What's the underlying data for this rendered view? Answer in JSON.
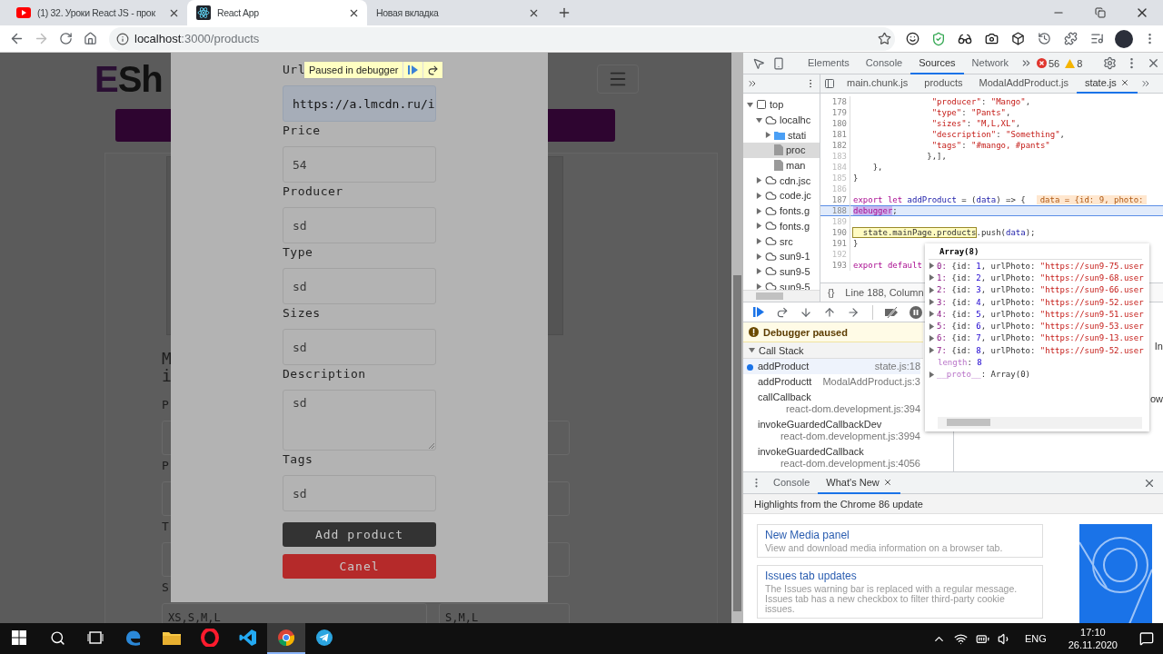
{
  "browser": {
    "tabs": [
      {
        "title": "(1) 32. Уроки React JS - прок",
        "kind": "youtube",
        "selected": false
      },
      {
        "title": "React App",
        "kind": "react",
        "selected": true
      },
      {
        "title": "Новая вкладка",
        "selected": false
      }
    ],
    "address": {
      "host": "localhost",
      "path": ":3000/products"
    }
  },
  "page": {
    "logo": {
      "first": "E",
      "rest": "Sh"
    },
    "title_lines": [
      "M",
      "i"
    ],
    "form_rows": [
      {
        "label": "P"
      },
      {
        "label": "P"
      },
      {
        "label": "T"
      },
      {
        "label": "S",
        "left_value": "XS,S,M,L",
        "right_value": "S,M,L"
      }
    ]
  },
  "modal": {
    "fields": [
      {
        "label": "Url",
        "value": "https://a.lmcdn.ru/i",
        "kind": "input",
        "autofilled": true
      },
      {
        "label": "Price",
        "value": "54",
        "kind": "input",
        "autofilled": false
      },
      {
        "label": "Producer",
        "value": "sd",
        "kind": "input",
        "autofilled": false
      },
      {
        "label": "Type",
        "value": "sd",
        "kind": "input",
        "autofilled": false
      },
      {
        "label": "Sizes",
        "value": "sd",
        "kind": "input",
        "autofilled": false
      },
      {
        "label": "Description",
        "value": "sd",
        "kind": "textarea",
        "autofilled": false
      },
      {
        "label": "Tags",
        "value": "sd",
        "kind": "input",
        "autofilled": false
      }
    ],
    "buttons": [
      {
        "label": "Add product",
        "kind": "primary"
      },
      {
        "label": "Canel",
        "kind": "danger"
      }
    ]
  },
  "debugger_badge": {
    "text": "Paused in debugger"
  },
  "devtools": {
    "panel_tabs": [
      {
        "label": "Elements",
        "selected": false
      },
      {
        "label": "Console",
        "selected": false
      },
      {
        "label": "Sources",
        "selected": true
      },
      {
        "label": "Network",
        "selected": false
      }
    ],
    "errors": "56",
    "warnings": "8",
    "file_tabs": [
      {
        "label": "main.chunk.js",
        "selected": false
      },
      {
        "label": "products",
        "selected": false
      },
      {
        "label": "ModalAddProduct.js",
        "selected": false
      },
      {
        "label": "state.js",
        "selected": true
      }
    ],
    "navigator": [
      {
        "label": "top",
        "kind": "frame",
        "selected": false,
        "expanded": true,
        "children": [
          {
            "label": "localhc",
            "kind": "cloud",
            "selected": false,
            "expanded": true,
            "children": [
              {
                "label": "stati",
                "kind": "folder",
                "selected": false,
                "expanded": false
              },
              {
                "label": "proc",
                "kind": "file",
                "selected": true
              },
              {
                "label": "man",
                "kind": "file",
                "selected": false
              }
            ]
          },
          {
            "label": "cdn.jsc",
            "kind": "cloud",
            "selected": false,
            "expanded": false
          },
          {
            "label": "code.jc",
            "kind": "cloud",
            "selected": false,
            "expanded": false
          },
          {
            "label": "fonts.g",
            "kind": "cloud",
            "selected": false,
            "expanded": false
          },
          {
            "label": "fonts.g",
            "kind": "cloud",
            "selected": false,
            "expanded": false
          },
          {
            "label": "src",
            "kind": "cloud",
            "selected": false,
            "expanded": false
          },
          {
            "label": "sun9-1",
            "kind": "cloud",
            "selected": false,
            "expanded": false
          },
          {
            "label": "sun9-5",
            "kind": "cloud",
            "selected": false,
            "expanded": false
          },
          {
            "label": "sun9-5",
            "kind": "cloud",
            "selected": false,
            "expanded": false
          }
        ]
      }
    ],
    "code_lines": [
      {
        "number": "178",
        "muted": false,
        "current": false,
        "tokens": [
          {
            "kind": "s",
            "t": "                \"producer\""
          },
          {
            "kind": "p",
            "t": ": "
          },
          {
            "kind": "s",
            "t": "\"Mango\""
          },
          {
            "kind": "p",
            "t": ","
          }
        ]
      },
      {
        "number": "179",
        "muted": false,
        "current": false,
        "tokens": [
          {
            "kind": "s",
            "t": "                \"type\""
          },
          {
            "kind": "p",
            "t": ": "
          },
          {
            "kind": "s",
            "t": "\"Pants\""
          },
          {
            "kind": "p",
            "t": ","
          }
        ]
      },
      {
        "number": "180",
        "muted": false,
        "current": false,
        "tokens": [
          {
            "kind": "s",
            "t": "                \"sizes\""
          },
          {
            "kind": "p",
            "t": ": "
          },
          {
            "kind": "s",
            "t": "\"M,L,XL\""
          },
          {
            "kind": "p",
            "t": ","
          }
        ]
      },
      {
        "number": "181",
        "muted": false,
        "current": false,
        "tokens": [
          {
            "kind": "s",
            "t": "                \"description\""
          },
          {
            "kind": "p",
            "t": ": "
          },
          {
            "kind": "s",
            "t": "\"Something\""
          },
          {
            "kind": "p",
            "t": ","
          }
        ]
      },
      {
        "number": "182",
        "muted": false,
        "current": false,
        "tokens": [
          {
            "kind": "s",
            "t": "                \"tags\""
          },
          {
            "kind": "p",
            "t": ": "
          },
          {
            "kind": "s",
            "t": "\"#mango, #pants\""
          }
        ]
      },
      {
        "number": "183",
        "muted": true,
        "current": false,
        "tokens": [
          {
            "kind": "p",
            "t": "               },],"
          }
        ]
      },
      {
        "number": "184",
        "muted": true,
        "current": false,
        "tokens": [
          {
            "kind": "p",
            "t": "    },"
          }
        ]
      },
      {
        "number": "185",
        "muted": true,
        "current": false,
        "tokens": [
          {
            "kind": "p",
            "t": "}"
          }
        ]
      },
      {
        "number": "186",
        "muted": true,
        "current": false
      },
      {
        "number": "187",
        "muted": false,
        "current": false,
        "tokens": [
          {
            "kind": "k",
            "t": "export let "
          },
          {
            "kind": "d",
            "t": "addProduct"
          },
          {
            "kind": "p",
            "t": " = ("
          },
          {
            "kind": "v",
            "t": "data"
          },
          {
            "kind": "p",
            "t": ") => {"
          }
        ],
        "inline_value": "data = {id: 9, photo:"
      },
      {
        "number": "188",
        "muted": false,
        "current": true,
        "tokens": [
          {
            "kind": "sel",
            "t": "debugger"
          },
          {
            "kind": "p",
            "t": ";"
          }
        ]
      },
      {
        "number": "189",
        "muted": true,
        "current": false
      },
      {
        "number": "190",
        "muted": false,
        "current": false,
        "tokens": [
          {
            "kind": "hover",
            "t": "  state.mainPage.products"
          },
          {
            "kind": "p",
            "t": ".push("
          },
          {
            "kind": "v",
            "t": "data"
          },
          {
            "kind": "p",
            "t": ");"
          }
        ]
      },
      {
        "number": "191",
        "muted": false,
        "current": false,
        "tokens": [
          {
            "kind": "p",
            "t": "}"
          }
        ]
      },
      {
        "number": "192",
        "muted": true,
        "current": false
      },
      {
        "number": "193",
        "muted": false,
        "current": false,
        "tokens": [
          {
            "kind": "k",
            "t": "export default"
          }
        ]
      }
    ],
    "status": {
      "pretty": "{}",
      "position": "Line 188, Column"
    },
    "paused_message": "Debugger paused",
    "call_stack": {
      "title": "Call Stack",
      "expanded": true,
      "frames": [
        {
          "name": "addProduct",
          "location": "state.js:18",
          "selected": true
        },
        {
          "name": "addProductt",
          "location": "ModalAddProduct.js:3",
          "selected": false
        },
        {
          "name": "callCallback",
          "location": "react-dom.development.js:394",
          "selected": false
        },
        {
          "name": "invokeGuardedCallbackDev",
          "location": "react-dom.development.js:3994",
          "selected": false
        },
        {
          "name": "invokeGuardedCallback",
          "location": "react-dom.development.js:4056",
          "selected": false
        }
      ]
    },
    "scope_fragments": [
      "In",
      "ow"
    ],
    "popover": {
      "title": "Array(8)",
      "rows": [
        {
          "expandable": true,
          "tokens": [
            {
              "kind": "i",
              "t": "0:"
            },
            {
              "kind": "p",
              "t": " {id: "
            },
            {
              "kind": "n",
              "t": "1"
            },
            {
              "kind": "p",
              "t": ", urlPhoto: "
            },
            {
              "kind": "s",
              "t": "\"https://sun9-75.user"
            }
          ]
        },
        {
          "expandable": true,
          "tokens": [
            {
              "kind": "i",
              "t": "1:"
            },
            {
              "kind": "p",
              "t": " {id: "
            },
            {
              "kind": "n",
              "t": "2"
            },
            {
              "kind": "p",
              "t": ", urlPhoto: "
            },
            {
              "kind": "s",
              "t": "\"https://sun9-68.user"
            }
          ]
        },
        {
          "expandable": true,
          "tokens": [
            {
              "kind": "i",
              "t": "2:"
            },
            {
              "kind": "p",
              "t": " {id: "
            },
            {
              "kind": "n",
              "t": "3"
            },
            {
              "kind": "p",
              "t": ", urlPhoto: "
            },
            {
              "kind": "s",
              "t": "\"https://sun9-66.user"
            }
          ]
        },
        {
          "expandable": true,
          "tokens": [
            {
              "kind": "i",
              "t": "3:"
            },
            {
              "kind": "p",
              "t": " {id: "
            },
            {
              "kind": "n",
              "t": "4"
            },
            {
              "kind": "p",
              "t": ", urlPhoto: "
            },
            {
              "kind": "s",
              "t": "\"https://sun9-52.user"
            }
          ]
        },
        {
          "expandable": true,
          "tokens": [
            {
              "kind": "i",
              "t": "4:"
            },
            {
              "kind": "p",
              "t": " {id: "
            },
            {
              "kind": "n",
              "t": "5"
            },
            {
              "kind": "p",
              "t": ", urlPhoto: "
            },
            {
              "kind": "s",
              "t": "\"https://sun9-51.user"
            }
          ]
        },
        {
          "expandable": true,
          "tokens": [
            {
              "kind": "i",
              "t": "5:"
            },
            {
              "kind": "p",
              "t": " {id: "
            },
            {
              "kind": "n",
              "t": "6"
            },
            {
              "kind": "p",
              "t": ", urlPhoto: "
            },
            {
              "kind": "s",
              "t": "\"https://sun9-53.user"
            }
          ]
        },
        {
          "expandable": true,
          "tokens": [
            {
              "kind": "i",
              "t": "6:"
            },
            {
              "kind": "p",
              "t": " {id: "
            },
            {
              "kind": "n",
              "t": "7"
            },
            {
              "kind": "p",
              "t": ", urlPhoto: "
            },
            {
              "kind": "s",
              "t": "\"https://sun9-13.user"
            }
          ]
        },
        {
          "expandable": true,
          "tokens": [
            {
              "kind": "i",
              "t": "7:"
            },
            {
              "kind": "p",
              "t": " {id: "
            },
            {
              "kind": "n",
              "t": "8"
            },
            {
              "kind": "p",
              "t": ", urlPhoto: "
            },
            {
              "kind": "s",
              "t": "\"https://sun9-52.user"
            }
          ]
        },
        {
          "expandable": false,
          "tokens": [
            {
              "kind": "pr",
              "t": "length"
            },
            {
              "kind": "p",
              "t": ": "
            },
            {
              "kind": "n",
              "t": "8"
            }
          ]
        },
        {
          "expandable": true,
          "tokens": [
            {
              "kind": "pr",
              "t": "__proto__"
            },
            {
              "kind": "p",
              "t": ": Array(0)"
            }
          ]
        }
      ]
    },
    "drawer": {
      "tabs": [
        {
          "label": "Console",
          "selected": false,
          "closable": false
        },
        {
          "label": "What's New",
          "selected": true,
          "closable": true
        }
      ],
      "heading": "Highlights from the Chrome 86 update",
      "cards": [
        {
          "title": "New Media panel",
          "text": "View and download media information on a browser tab."
        },
        {
          "title": "Issues tab updates",
          "text": "The Issues warning bar is replaced with a regular message. Issues tab has a new checkbox to filter third-party cookie issues."
        }
      ]
    }
  },
  "taskbar": {
    "apps": [
      {
        "kind": "edge",
        "active": false
      },
      {
        "kind": "folder",
        "active": false
      },
      {
        "kind": "opera",
        "active": false
      },
      {
        "kind": "vscode",
        "active": false
      },
      {
        "kind": "chrome",
        "active": true
      },
      {
        "kind": "telegram",
        "active": false
      }
    ],
    "language": "ENG",
    "time": "17:10",
    "date": "26.11.2020"
  }
}
